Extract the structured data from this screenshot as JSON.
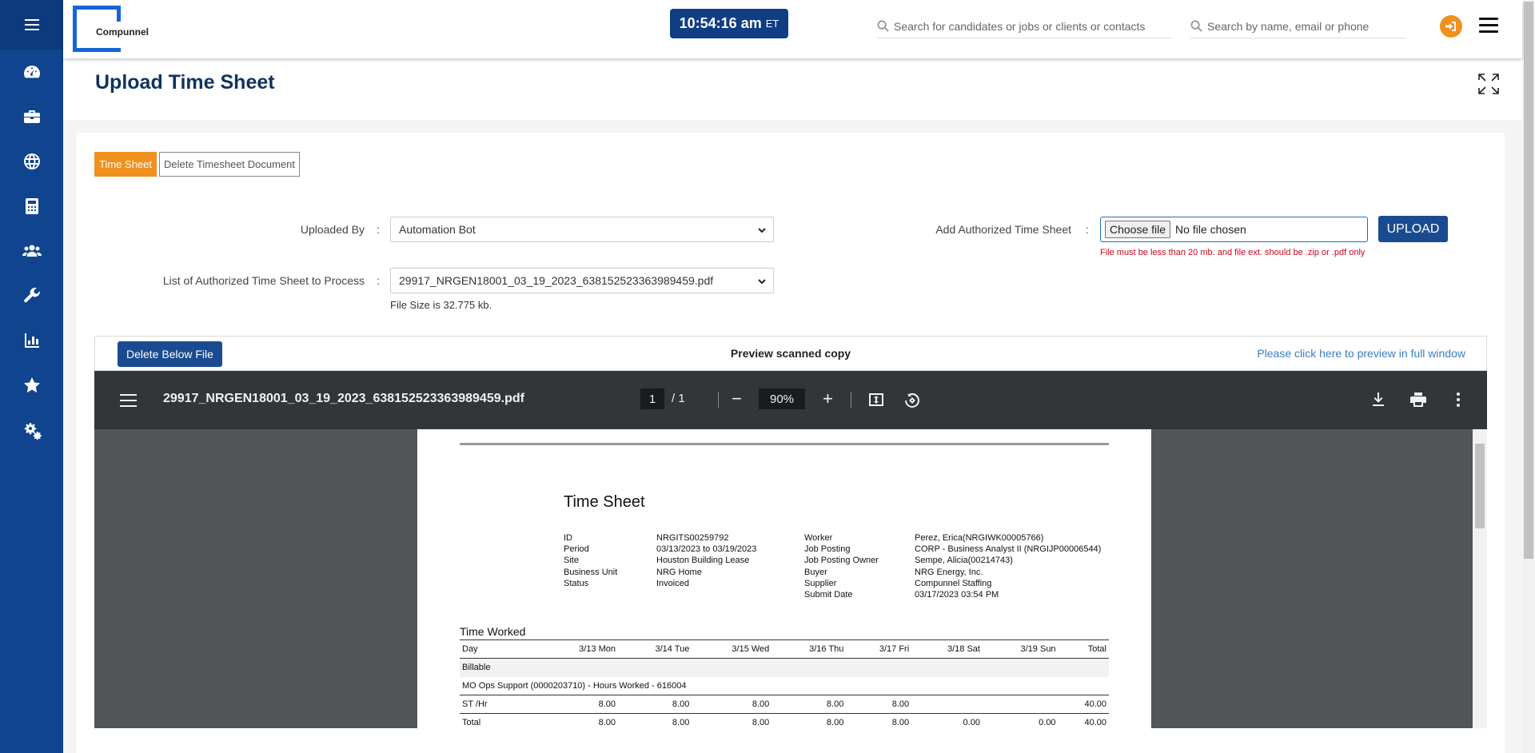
{
  "app": {
    "logo_text": "Compunnel",
    "clock_time": "10:54:16 am",
    "clock_zone": "ET"
  },
  "search": {
    "primary_placeholder": "Search for candidates or jobs or clients or contacts",
    "secondary_placeholder": "Search by name, email or phone"
  },
  "sidebar": {
    "items": [
      "menu-icon",
      "dashboard-icon",
      "briefcase-icon",
      "globe-icon",
      "calculator-icon",
      "users-icon",
      "wrench-icon",
      "bar-chart-icon",
      "star-icon",
      "settings-icon"
    ]
  },
  "page": {
    "title": "Upload Time Sheet"
  },
  "tabs": [
    "Time Sheet",
    "Delete Timesheet Document"
  ],
  "form": {
    "uploaded_by_label": "Uploaded By",
    "uploaded_by_value": "Automation Bot",
    "list_label": "List of Authorized Time Sheet to Process",
    "list_value": "29917_NRGEN18001_03_19_2023_638152523363989459.pdf",
    "file_size": "File Size is 32.775 kb.",
    "add_label": "Add Authorized Time Sheet",
    "choose_file": "Choose file",
    "no_file": "No file chosen",
    "upload_button": "UPLOAD",
    "hint": "File must be less than 20 mb. and file ext. should be .zip or .pdf only",
    "colon": ":"
  },
  "preview": {
    "delete_button": "Delete Below File",
    "title": "Preview scanned copy",
    "link": "Please click here to preview in full window"
  },
  "viewer": {
    "filename": "29917_NRGEN18001_03_19_2023_638152523363989459.pdf",
    "page_current": "1",
    "page_total": "/   1",
    "zoom": "90%",
    "minus": "−",
    "plus": "+"
  },
  "document": {
    "title": "Time Sheet",
    "left_labels": [
      "ID",
      "Period",
      "Site",
      "Business Unit",
      "Status"
    ],
    "left_values": [
      "NRGITS00259792",
      "03/13/2023 to 03/19/2023",
      "Houston Building Lease",
      "NRG Home",
      "Invoiced"
    ],
    "right_labels": [
      "Worker",
      "Job Posting",
      "Job Posting Owner",
      "Buyer",
      "Supplier",
      "Submit Date"
    ],
    "right_values": [
      "Perez, Erica(NRGIWK00005766)",
      "CORP - Business Analyst II (NRGIJP00006544)",
      "Sempe, Alicia(00214743)",
      "NRG Energy, Inc.",
      "Compunnel Staffing",
      "03/17/2023 03:54 PM"
    ],
    "time_worked": "Time Worked",
    "columns": [
      "Day",
      "3/13 Mon",
      "3/14 Tue",
      "3/15 Wed",
      "3/16 Thu",
      "3/17 Fri",
      "3/18 Sat",
      "3/19 Sun",
      "Total"
    ],
    "billable": "Billable",
    "project": "MO Ops Support (0000203710) - Hours Worked - 616004",
    "st_row": [
      "ST /Hr",
      "8.00",
      "8.00",
      "8.00",
      "8.00",
      "8.00",
      "",
      "",
      "40.00"
    ],
    "total_row": [
      "Total",
      "8.00",
      "8.00",
      "8.00",
      "8.00",
      "8.00",
      "0.00",
      "0.00",
      "40.00"
    ]
  }
}
